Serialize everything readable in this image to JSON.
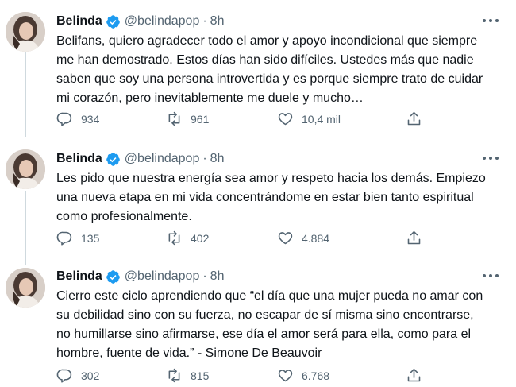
{
  "colors": {
    "text": "#0f1419",
    "secondary": "#536471",
    "verified": "#1d9bf0",
    "thread_line": "#cfd9de"
  },
  "tweets": [
    {
      "author_name": "Belinda",
      "handle": "@belindapop",
      "separator": "·",
      "time": "8h",
      "lines": [
        "Belifans, quiero agradecer todo el amor y apoyo incondicional que siempre",
        "me han demostrado. Estos días han sido difíciles. Ustedes más que nadie",
        "saben que soy una persona introvertida y es porque siempre trato de cuidar",
        "mi corazón, pero inevitablemente me duele y mucho…"
      ],
      "replies": "934",
      "retweets": "961",
      "likes": "10,4 mil"
    },
    {
      "author_name": "Belinda",
      "handle": "@belindapop",
      "separator": "·",
      "time": "8h",
      "lines": [
        "Les pido que nuestra energía sea amor y respeto hacia los demás. Empiezo",
        "una nueva etapa en mi vida concentrándome en estar bien tanto espiritual",
        "como profesionalmente."
      ],
      "replies": "135",
      "retweets": "402",
      "likes": "4.884"
    },
    {
      "author_name": "Belinda",
      "handle": "@belindapop",
      "separator": "·",
      "time": "8h",
      "lines": [
        "Cierro este ciclo aprendiendo que “el día que una mujer pueda no amar con",
        "su debilidad sino con su fuerza, no escapar de sí misma sino encontrarse,",
        "no humillarse sino afirmarse, ese día el amor será para ella, como para el",
        "hombre, fuente de vida.” - Simone De Beauvoir"
      ],
      "replies": "302",
      "retweets": "815",
      "likes": "6.768"
    }
  ]
}
